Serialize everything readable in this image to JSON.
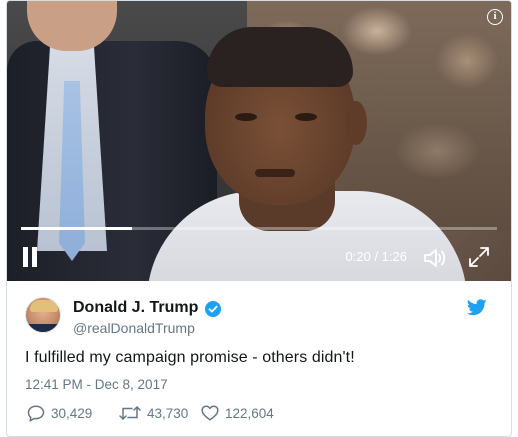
{
  "video": {
    "current_time": "0:20",
    "duration": "1:26",
    "time_display": "0:20 / 1:26",
    "progress_fraction": 0.233,
    "info_icon": "info-icon",
    "pause_icon": "pause-icon",
    "volume_icon": "volume-icon",
    "fullscreen_icon": "fullscreen-icon"
  },
  "tweet": {
    "author_name": "Donald J. Trump",
    "handle": "@realDonaldTrump",
    "verified": true,
    "text": "I fulfilled my campaign promise - others didn't!",
    "timestamp": "12:41 PM - Dec 8, 2017",
    "replies": "30,429",
    "retweets": "43,730",
    "likes": "122,604"
  },
  "colors": {
    "twitter_blue": "#1da1f2",
    "text_primary": "#14171a",
    "text_secondary": "#657786",
    "border": "#d5dce2"
  }
}
